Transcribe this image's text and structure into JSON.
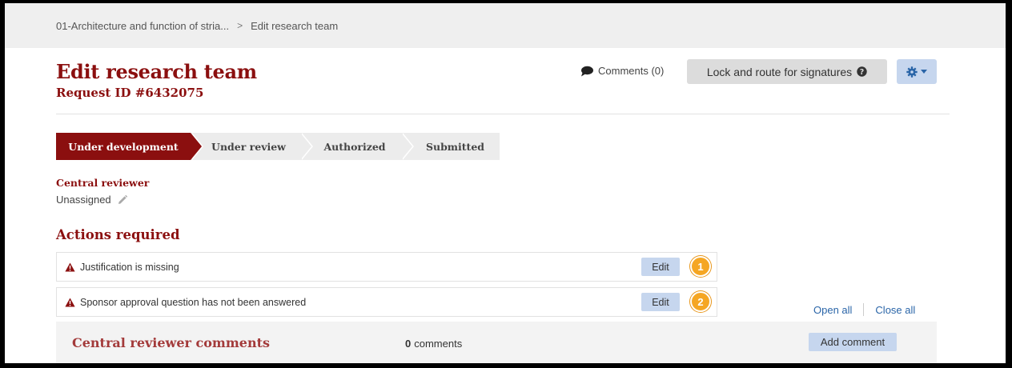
{
  "breadcrumb": {
    "parent": "01-Architecture and function of stria...",
    "separator": ">",
    "current": "Edit research team"
  },
  "header": {
    "title": "Edit research team",
    "request_id": "Request ID #6432075",
    "comments_label": "Comments (0)",
    "lock_button": "Lock and route for signatures"
  },
  "stepper": {
    "steps": [
      {
        "label": "Under development",
        "active": true
      },
      {
        "label": "Under review",
        "active": false
      },
      {
        "label": "Authorized",
        "active": false
      },
      {
        "label": "Submitted",
        "active": false
      }
    ]
  },
  "reviewer": {
    "label": "Central reviewer",
    "value": "Unassigned"
  },
  "actions": {
    "heading": "Actions required",
    "items": [
      {
        "text": "Justification is missing",
        "button": "Edit",
        "badge": "1"
      },
      {
        "text": "Sponsor approval question has not been answered",
        "button": "Edit",
        "badge": "2"
      }
    ],
    "open_all": "Open all",
    "close_all": "Close all"
  },
  "comments_panel": {
    "title": "Central reviewer comments",
    "count": "0",
    "count_label": "comments",
    "add_button": "Add comment"
  },
  "colors": {
    "brand": "#8b0f0f",
    "button_blue": "#c6d6ee",
    "badge_orange": "#f5a623",
    "link_blue": "#2a65a8"
  }
}
